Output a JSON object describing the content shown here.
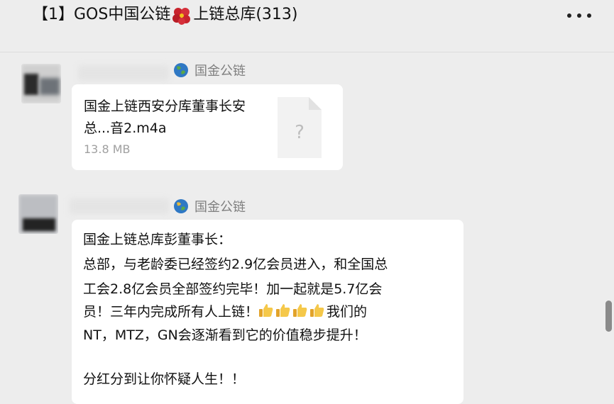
{
  "header": {
    "title_prefix": "【1】GOS中国公链",
    "title_suffix": "上链总库(313)"
  },
  "messages": [
    {
      "sender": "国金公链",
      "file_name": "国金上链西安分库董事长安总...音2.m4a",
      "file_size": "13.8 MB",
      "file_icon": "unknown-file-icon"
    },
    {
      "sender": "国金公链",
      "lines": [
        "国金上链总库彭董事长：",
        "总部，与老龄委已经签约2.9亿会员进入，和全国总",
        "工会2.8亿会员全部签约完毕！加一起就是5.7亿会",
        "员！三年内完成所有人上链！",
        "我们的",
        "NT，MTZ，GN会逐渐看到它的价值稳步提升！",
        "分红分到让你怀疑人生！！"
      ]
    }
  ],
  "colors": {
    "background": "#ededed",
    "bubble": "#ffffff",
    "muted": "#7f7f7f"
  }
}
